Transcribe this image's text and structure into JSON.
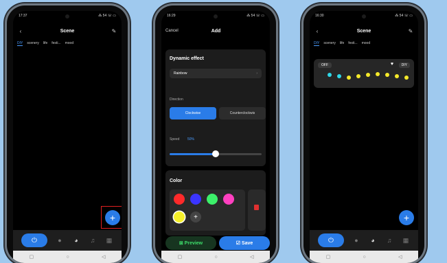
{
  "phone1": {
    "status_time": "17:37",
    "status_right": "⁂ 54 ☏ ▭",
    "title": "Scene",
    "tabs": [
      "DIY",
      "scenery",
      "life",
      "festi...",
      "mood"
    ],
    "fab": "+"
  },
  "phone2": {
    "status_time": "16:29",
    "status_right": "⁂ 54 ☏ ▭",
    "cancel": "Cancel",
    "title": "Add",
    "dynamic_effect_label": "Dynamic effect",
    "effect_value": "Rainbow",
    "direction_label": "Direction",
    "direction_options": [
      "Clockwise",
      "Counterclockwis"
    ],
    "speed_label": "Speed",
    "speed_value": "50%",
    "speed_fraction": 0.5,
    "color_label": "Color",
    "colors": [
      "#ff2a2a",
      "#3b35ff",
      "#3cf06a",
      "#ff40c0",
      "#f5f02a"
    ],
    "add_color": "+",
    "preview": "⊠ Preview",
    "save": "☑ Save"
  },
  "phone3": {
    "status_time": "16:30",
    "status_right": "⁂ 54 ☏ ▭",
    "title": "Scene",
    "tabs": [
      "DIY",
      "scenery",
      "life",
      "festi...",
      "mood"
    ],
    "card_off": "OFF",
    "card_heart": "♥",
    "card_diy": "DIY",
    "lights": [
      "#2fd8e8",
      "#2fd8e8",
      "#f5e92a",
      "#f5e92a",
      "#f5e92a",
      "#f5e92a",
      "#f5e92a",
      "#f5e92a",
      "#f5e92a"
    ],
    "fab": "+"
  },
  "icons": {
    "back": "‹",
    "edit": "✎",
    "power": "⏻",
    "bulb": "●",
    "palette": "◕",
    "music": "♫",
    "grid": "▦",
    "sys_square": "▢",
    "sys_circle": "○",
    "sys_back": "◁"
  }
}
